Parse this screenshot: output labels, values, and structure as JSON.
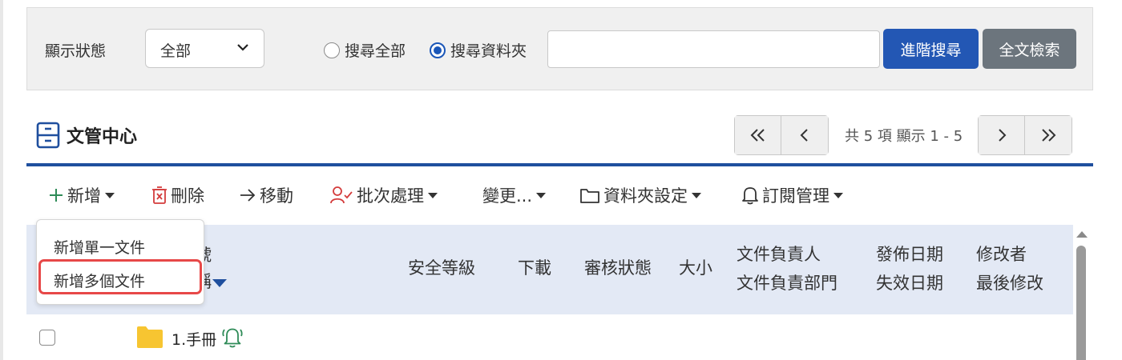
{
  "filter": {
    "status_label": "顯示狀態",
    "status_value": "全部",
    "radio_all": "搜尋全部",
    "radio_folder": "搜尋資料夾",
    "radio_selected": "搜尋資料夾",
    "search_value": "",
    "advanced_search": "進階搜尋",
    "full_text_search": "全文檢索"
  },
  "header": {
    "title": "文管中心"
  },
  "pager": {
    "info": "共 5 項 顯示 1 - 5"
  },
  "toolbar": {
    "add": "新增",
    "delete": "刪除",
    "move": "移動",
    "batch": "批次處理",
    "change": "變更...",
    "folder_settings": "資料夾設定",
    "subscription": "訂閱管理"
  },
  "dropdown": {
    "items": [
      "新增單一文件",
      "新增多個文件"
    ],
    "highlighted": "新增多個文件"
  },
  "table": {
    "partial_header_1": "號",
    "partial_header_2": "稱",
    "headers": {
      "security": "安全等級",
      "download": "下載",
      "review": "審核狀態",
      "size": "大小",
      "owner": "文件負責人",
      "owner_dept": "文件負責部門",
      "publish_date": "發佈日期",
      "expire_date": "失效日期",
      "modifier": "修改者",
      "last_modified": "最後修改"
    },
    "rows": [
      {
        "name": "1.手冊"
      }
    ]
  },
  "colors": {
    "primary": "#2357b4",
    "secondary": "#6c757d",
    "header_bg": "#e3e9f5",
    "highlight": "#e74848",
    "folder": "#f7c531",
    "bell": "#2e8b57"
  },
  "icons": [
    "chevron-down-icon",
    "plus-icon",
    "trash-icon",
    "arrow-right-icon",
    "user-check-icon",
    "folder-icon",
    "bell-icon",
    "cabinet-icon",
    "double-left-icon",
    "left-icon",
    "right-icon",
    "double-right-icon"
  ]
}
